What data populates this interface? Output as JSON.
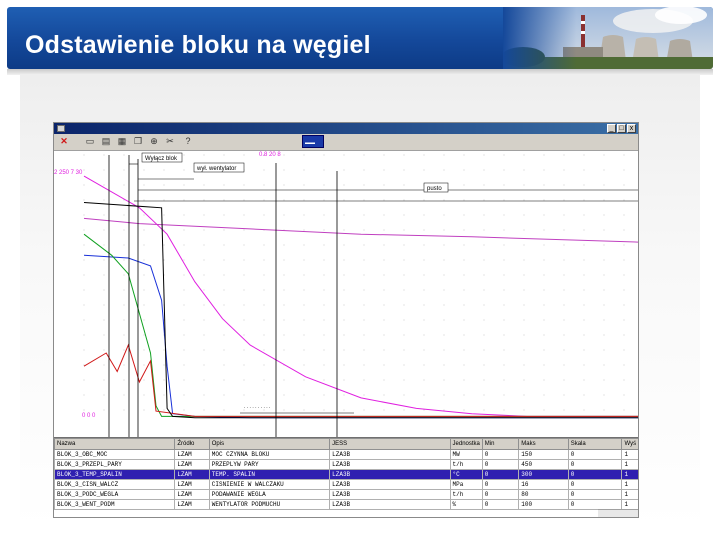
{
  "slide": {
    "title": "Odstawienie bloku na węgiel"
  },
  "colors": {
    "header_blue": "#1554a8",
    "trace_magenta": "#e020e0",
    "trace_blue": "#1830d8",
    "trace_green": "#10a020",
    "trace_red": "#d01818",
    "trace_black": "#000000",
    "selected_row": "#2f1fb0"
  },
  "window": {
    "title": "",
    "buttons": [
      "_",
      "□",
      "x"
    ]
  },
  "toolbar": {
    "icons": [
      "close-icon",
      "open-icon",
      "save-icon",
      "print-icon",
      "copy-icon",
      "zoom-icon",
      "scissors-icon",
      "help-icon"
    ],
    "help_glyph": "?"
  },
  "chart": {
    "annotations": {
      "ann_top": "Wyłącz blok",
      "ann_mid": "wył. wentylator",
      "ann_right": "pusto"
    }
  },
  "chart_data": {
    "type": "line",
    "x_range": [
      0,
      100
    ],
    "y_range": [
      0,
      100
    ],
    "grid": true,
    "series": [
      {
        "color": "#e020e0",
        "x": [
          0,
          10,
          15,
          20,
          25,
          30,
          40,
          50,
          60,
          70,
          80,
          100
        ],
        "y": [
          92,
          80,
          70,
          52,
          38,
          28,
          16,
          8,
          4,
          2,
          1,
          1
        ]
      },
      {
        "color": "#c040c0",
        "x": [
          0,
          10,
          20,
          30,
          50,
          70,
          100
        ],
        "y": [
          76,
          74,
          73,
          72,
          70,
          69,
          67
        ]
      },
      {
        "color": "#1830d8",
        "x": [
          0,
          8,
          12,
          14,
          15,
          16,
          20,
          30,
          50,
          100
        ],
        "y": [
          62,
          61,
          58,
          45,
          20,
          2,
          1,
          0.5,
          0.5,
          0.5
        ]
      },
      {
        "color": "#10a020",
        "x": [
          0,
          5,
          8,
          10,
          12,
          13,
          14,
          20,
          100
        ],
        "y": [
          70,
          62,
          55,
          40,
          25,
          5,
          1,
          1,
          1
        ]
      },
      {
        "color": "#d01818",
        "x": [
          0,
          4,
          6,
          8,
          10,
          12,
          13,
          20,
          100
        ],
        "y": [
          20,
          25,
          18,
          28,
          14,
          22,
          3,
          1,
          1
        ]
      },
      {
        "color": "#000000",
        "x": [
          0,
          14,
          15,
          16,
          20,
          100
        ],
        "y": [
          82,
          80,
          4,
          1,
          0.5,
          0.5
        ]
      }
    ]
  },
  "table": {
    "columns": [
      "Nazwa",
      "Źródło",
      "Opis",
      "JESS",
      "Jednostka",
      "Min",
      "Maks",
      "Skala",
      "Wyś"
    ],
    "rows": [
      [
        "BLOK_3_OBC_MOC",
        "LZAM",
        "MOC CZYNNA BLOKU",
        "LZA3B",
        "MW",
        "0",
        "150",
        "0",
        "1"
      ],
      [
        "BLOK_3_PRZEPL_PARY",
        "LZAM",
        "PRZEPLYW PARY",
        "LZA3B",
        "t/h",
        "0",
        "450",
        "0",
        "1"
      ],
      [
        "BLOK_3_TEMP_SPALIN",
        "LZAM",
        "TEMP. SPALIN",
        "LZA3B",
        "°C",
        "0",
        "300",
        "0",
        "1"
      ],
      [
        "BLOK_3_CISN_WALCZ",
        "LZAM",
        "CISNIENIE W WALCZAKU",
        "LZA3B",
        "MPa",
        "0",
        "16",
        "0",
        "1"
      ],
      [
        "BLOK_3_PODC_WEGLA",
        "LZAM",
        "PODAWANIE WEGLA",
        "LZA3B",
        "t/h",
        "0",
        "80",
        "0",
        "1"
      ],
      [
        "BLOK_3_WENT_PODM",
        "LZAM",
        "WENTYLATOR PODMUCHU",
        "LZA3B",
        "%",
        "0",
        "100",
        "0",
        "1"
      ]
    ],
    "selected_row": 2
  }
}
